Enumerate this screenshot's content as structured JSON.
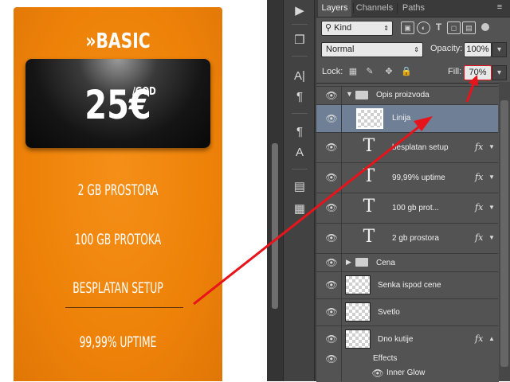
{
  "pricing_card": {
    "title": "»BASIC",
    "price": "25€",
    "price_unit": "/GOD",
    "features": [
      "2 GB PROSTORA",
      "100 GB PROTOKA",
      "BESPLATAN SETUP",
      "99,99% UPTIME"
    ],
    "accent_color": "#ee8209"
  },
  "photoshop": {
    "tabs": [
      "Layers",
      "Channels",
      "Paths"
    ],
    "filter": {
      "kind_label": "Kind"
    },
    "blend_mode": "Normal",
    "opacity_label": "Opacity:",
    "opacity_value": "100%",
    "lock_label": "Lock:",
    "fill_label": "Fill:",
    "fill_value": "70%",
    "tools": [
      "play-icon",
      "3d-cube-icon",
      "character-icon",
      "paragraph-icon",
      "paragraph-style-icon",
      "character-style-icon",
      "notes-icon",
      "info-icon"
    ],
    "layers": [
      {
        "name": "Opis proizvoda",
        "type": "group",
        "expanded": true
      },
      {
        "name": "Linija",
        "type": "shape",
        "selected": true
      },
      {
        "name": "besplatan      setup",
        "type": "text",
        "fx": true
      },
      {
        "name": "99,99%      uptime",
        "type": "text",
        "fx": true
      },
      {
        "name": "100      gb      prot...",
        "type": "text",
        "fx": true
      },
      {
        "name": "2      gb      prostora",
        "type": "text",
        "fx": true
      },
      {
        "name": "Cena",
        "type": "group",
        "expanded": false
      },
      {
        "name": "Senka ispod cene",
        "type": "pixel"
      },
      {
        "name": "Svetlo",
        "type": "pixel"
      },
      {
        "name": "Dno kutije",
        "type": "shape",
        "fx": true
      },
      {
        "name": "Effects",
        "type": "effects"
      },
      {
        "name": "Inner Glow",
        "type": "effect"
      }
    ],
    "fx_label": "fx",
    "selection_color": "#6e7f96",
    "annotation_color": "#e8141b"
  }
}
